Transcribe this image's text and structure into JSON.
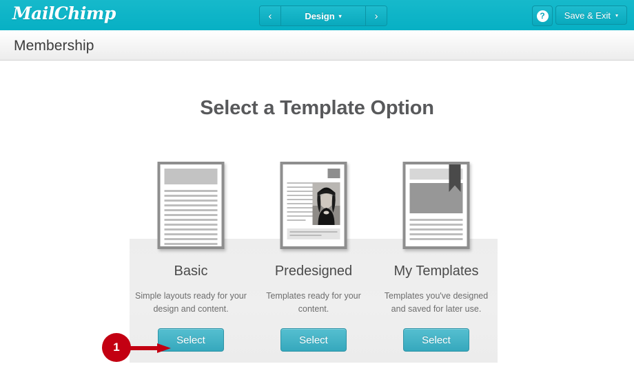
{
  "header": {
    "logo_text": "MailChimp",
    "brand_color": "#0fb6c8",
    "nav": {
      "prev_icon": "‹",
      "next_icon": "›",
      "current_step": "Design",
      "caret_icon": "▾"
    },
    "help_label": "?",
    "save_exit_label": "Save & Exit",
    "save_exit_caret": "▾"
  },
  "subheader": {
    "title": "Membership"
  },
  "main": {
    "page_title": "Select a Template Option",
    "cards": [
      {
        "title": "Basic",
        "description": "Simple layouts ready for your design and content.",
        "button_label": "Select",
        "thumbnail": "basic-layout-thumbnail"
      },
      {
        "title": "Predesigned",
        "description": "Templates ready for your content.",
        "button_label": "Select",
        "thumbnail": "predesigned-layout-thumbnail"
      },
      {
        "title": "My Templates",
        "description": "Templates you've designed and saved for later use.",
        "button_label": "Select",
        "thumbnail": "my-templates-layout-thumbnail"
      }
    ]
  },
  "annotation": {
    "step_number": "1",
    "color": "#c30012",
    "points_to": "Select button for Basic"
  }
}
